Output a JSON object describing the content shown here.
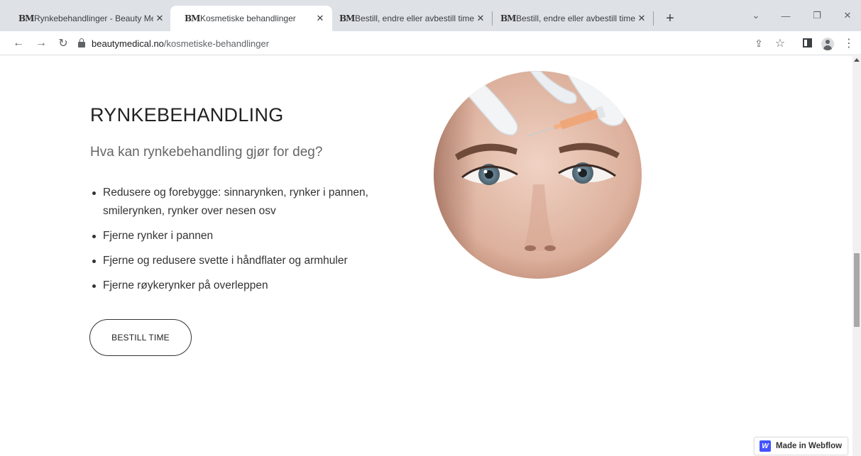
{
  "tabs": [
    {
      "favicon": "BM",
      "title": "Rynkebehandlinger - Beauty Medical",
      "active": false
    },
    {
      "favicon": "BM",
      "title": "Kosmetiske behandlinger",
      "active": true
    },
    {
      "favicon": "BM",
      "title": "Bestill, endre eller avbestill time - ",
      "active": false
    },
    {
      "favicon": "BM",
      "title": "Bestill, endre eller avbestill time - ",
      "active": false
    }
  ],
  "icons": {
    "close": "✕",
    "new_tab": "+",
    "tab_search": "⌄",
    "minimize": "—",
    "restore": "❐",
    "window_close": "✕",
    "back": "←",
    "forward": "→",
    "reload": "↻",
    "share": "⇪",
    "bookmark": "☆",
    "menu": "⋮"
  },
  "address_bar": {
    "host": "beautymedical.no",
    "path": "/kosmetiske-behandlinger"
  },
  "page": {
    "heading": "RYNKEBEHANDLING",
    "subheading": "Hva kan rynkebehandling gjør for deg?",
    "bullets": [
      "Redusere og forebygge: sinnarynken, rynker i pannen, smilerynken, rynker over nesen osv",
      "Fjerne rynker i pannen",
      "Fjerne og redusere svette i håndflater og armhuler",
      "Fjerne røykerynker på overleppen"
    ],
    "cta_label": "BESTILL TIME"
  },
  "badge": {
    "logo": "W",
    "label": "Made in Webflow",
    "color": "#4353ff"
  }
}
